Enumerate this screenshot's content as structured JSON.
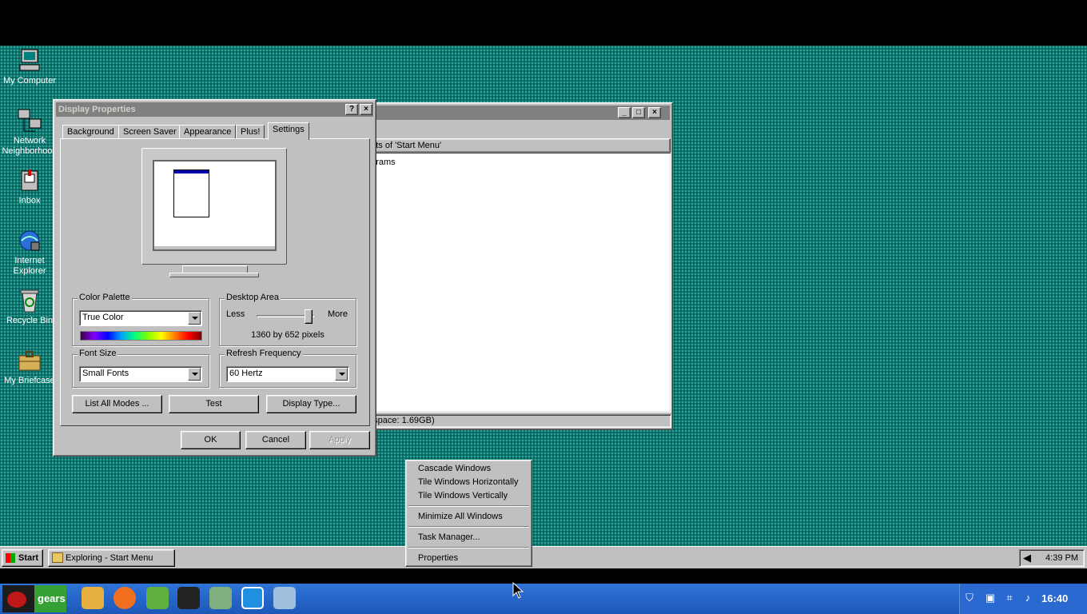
{
  "desktop": {
    "icons": [
      {
        "label": "My Computer",
        "icon": "my-computer-icon"
      },
      {
        "label": "Network Neighborhood",
        "icon": "network-neighborhood-icon"
      },
      {
        "label": "Inbox",
        "icon": "inbox-icon"
      },
      {
        "label": "Internet Explorer",
        "icon": "internet-explorer-icon"
      },
      {
        "label": "Recycle Bin",
        "icon": "recycle-bin-icon"
      },
      {
        "label": "My Briefcase",
        "icon": "briefcase-icon"
      }
    ]
  },
  "explorer": {
    "header": "ents of 'Start Menu'",
    "item": "ograms",
    "status": "e space: 1.69GB)"
  },
  "display_properties": {
    "title": "Display Properties",
    "tabs": [
      "Background",
      "Screen Saver",
      "Appearance",
      "Plus!",
      "Settings"
    ],
    "active_tab": "Settings",
    "color_palette": {
      "label": "Color Palette",
      "value": "True Color"
    },
    "desktop_area": {
      "label": "Desktop Area",
      "less": "Less",
      "more": "More",
      "resolution": "1360 by 652 pixels",
      "slider_level": 1.0
    },
    "font_size": {
      "label": "Font Size",
      "value": "Small Fonts"
    },
    "refresh": {
      "label": "Refresh Frequency",
      "value": "60 Hertz"
    },
    "buttons": {
      "list_modes": "List All Modes ...",
      "test": "Test",
      "display_type": "Display Type...",
      "ok": "OK",
      "cancel": "Cancel",
      "apply": "Apply"
    }
  },
  "context_menu": {
    "items": [
      "Cascade Windows",
      "Tile Windows Horizontally",
      "Tile Windows Vertically",
      "Minimize All Windows",
      "Task Manager...",
      "Properties"
    ]
  },
  "win_taskbar": {
    "start": "Start",
    "task": "Exploring - Start Menu",
    "clock": "4:39 PM"
  },
  "host_panel": {
    "menu_label": "gears",
    "clock": "16:40",
    "apps": [
      "files-icon",
      "browser-icon",
      "spreadsheet-icon",
      "terminal-icon",
      "settings-icon",
      "monitor-icon",
      "disc-icon"
    ],
    "tray": [
      "shield-icon",
      "clipboard-icon",
      "network-icon",
      "volume-icon"
    ],
    "colors": {
      "panel": "#2060c0",
      "desktop": "#0c7a72"
    }
  }
}
